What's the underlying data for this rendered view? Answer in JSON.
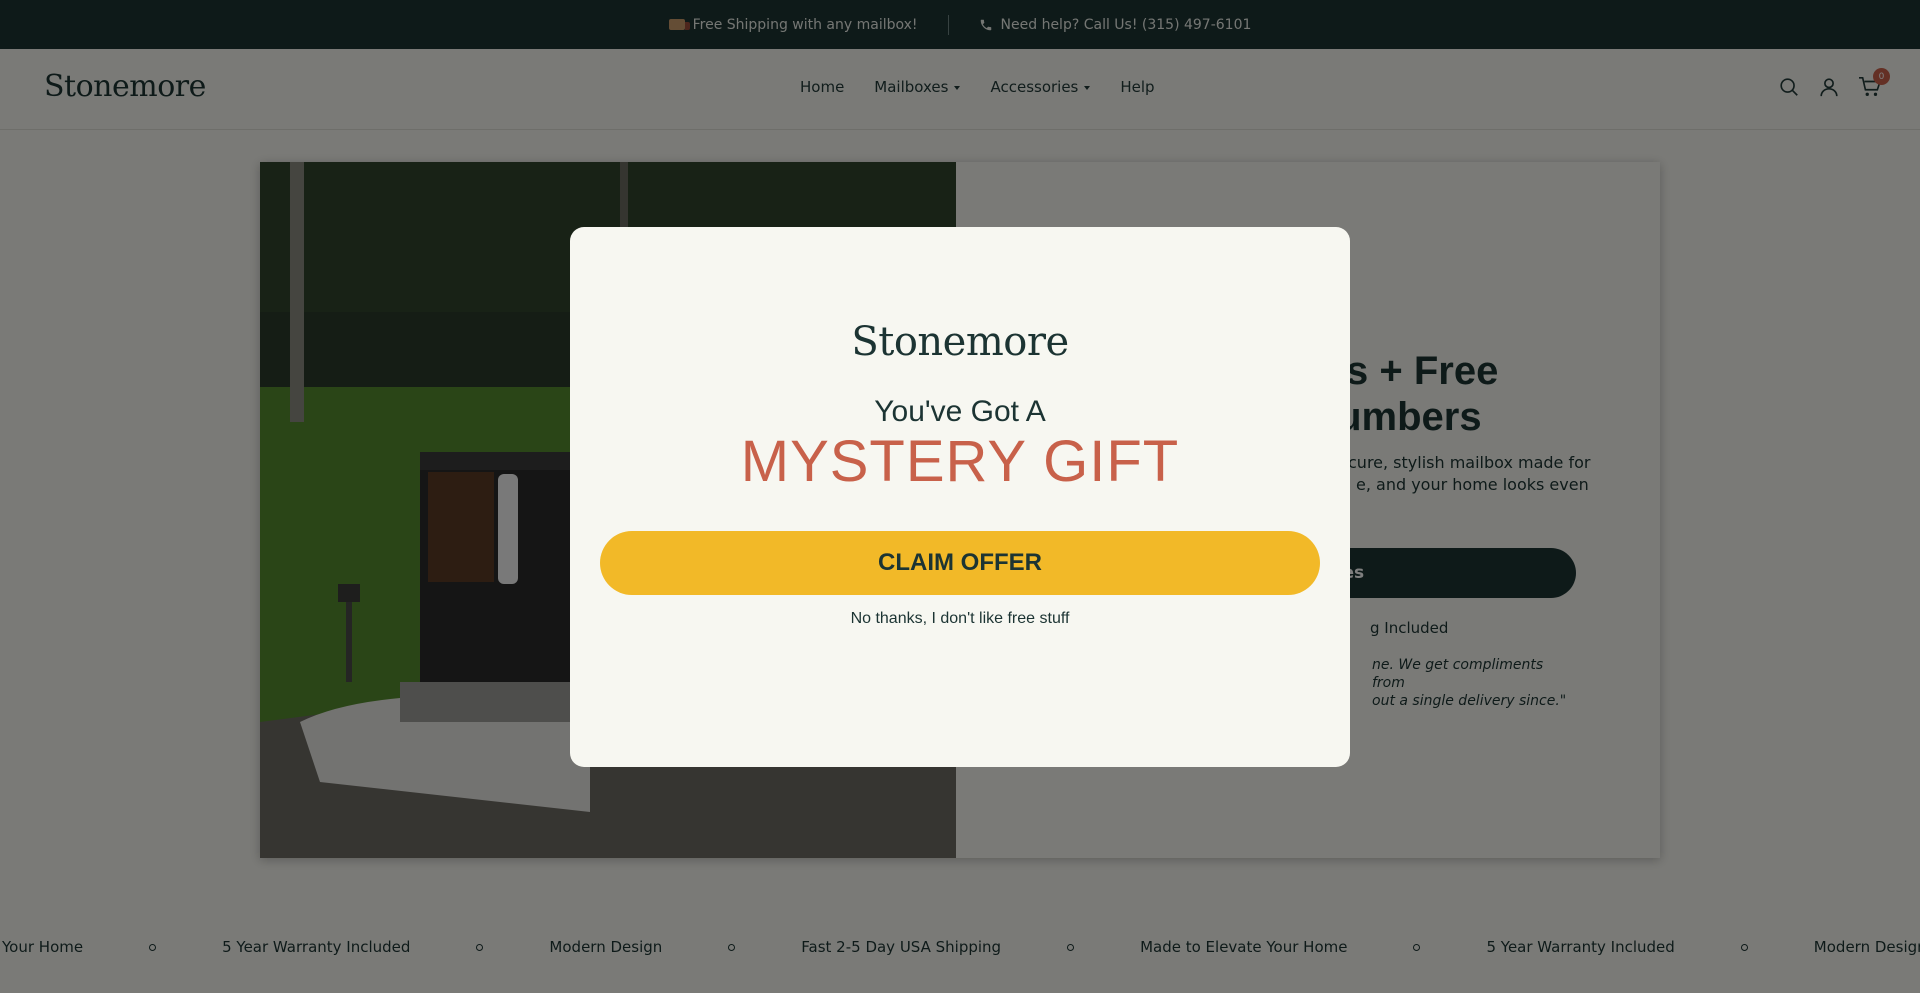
{
  "announcement": {
    "shipping_text": "Free Shipping with any mailbox!",
    "help_text": "Need help? Call Us! (315) 497-6101"
  },
  "header": {
    "logo": "Stonemore",
    "nav": [
      "Home",
      "Mailboxes",
      "Accessories",
      "Help"
    ],
    "cart_count": "0"
  },
  "hero": {
    "title_visible": "s + Free\nlumbers",
    "title_line1": "s + Free",
    "title_line2": "lumbers",
    "desc_line1": "cure, stylish mailbox made for",
    "desc_line2": "e, and your home looks even",
    "button_label": "oxes",
    "feature": "g Included",
    "quote_line1": "ne. We get compliments from",
    "quote_line2": "out a single delivery since.\""
  },
  "marquee": {
    "items": [
      "e Your Home",
      "5 Year Warranty Included",
      "Modern Design",
      "Fast 2-5 Day USA Shipping",
      "Made to Elevate Your Home",
      "5 Year Warranty Included",
      "Modern Design"
    ]
  },
  "modal": {
    "logo": "Stonemore",
    "subtitle": "You've Got A",
    "title": "MYSTERY GIFT",
    "cta": "CLAIM OFFER",
    "decline": "No thanks, I don't like free stuff"
  },
  "colors": {
    "brand_dark": "#1c3433",
    "accent_orange": "#c8614a",
    "cta_yellow": "#f2b928",
    "background": "#f5f5ef"
  }
}
